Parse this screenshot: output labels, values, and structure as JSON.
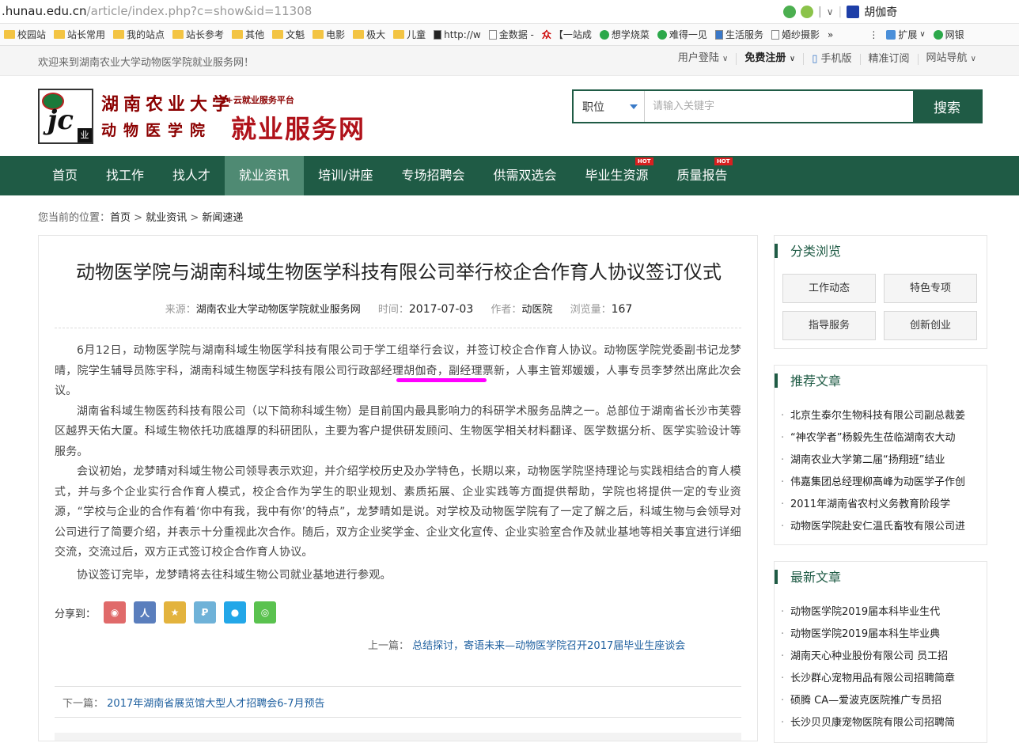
{
  "browser": {
    "url_domain": ".hunau.edu.cn",
    "url_path": "/article/index.php?c=show&id=11308",
    "user_name": "胡伽奇",
    "bookmarks": [
      "校园站",
      "站长常用",
      "我的站点",
      "站长参考",
      "其他",
      "文魁",
      "电影",
      "极大",
      "儿童",
      "http://w",
      "金数据 -",
      "【一站成",
      "想学烧菜",
      "难得一见",
      "生活服务",
      "婚纱摄影",
      "»",
      "⋮",
      "扩展",
      "网银"
    ]
  },
  "topbar": {
    "welcome": "欢迎来到湖南农业大学动物医学院就业服务网！",
    "links": [
      "用户登陆",
      "免费注册",
      "手机版",
      "精准订阅",
      "网站导航"
    ]
  },
  "logo": {
    "school": "湖南农业大学",
    "college": "动物医学院",
    "platform": "3+云就业服务平台",
    "site": "就业服务网",
    "badge_text": "jc",
    "badge_corner": "业"
  },
  "search": {
    "select_value": "职位",
    "placeholder": "请输入关键字",
    "button": "搜索"
  },
  "nav": {
    "items": [
      "首页",
      "找工作",
      "找人才",
      "就业资讯",
      "培训/讲座",
      "专场招聘会",
      "供需双选会",
      "毕业生资源",
      "质量报告"
    ],
    "active": "就业资讯",
    "hot_badge": "HOT"
  },
  "breadcrumb": {
    "prefix": "您当前的位置：",
    "items": [
      "首页",
      "就业资讯",
      "新闻速递"
    ],
    "sep": " > "
  },
  "article": {
    "title": "动物医学院与湖南科域生物医学科技有限公司举行校企合作育人协议签订仪式",
    "source_label": "来源：",
    "source": "湖南农业大学动物医学院就业服务网",
    "time_label": "时间：",
    "time": "2017-07-03",
    "author_label": "作者：",
    "author": "动医院",
    "views_label": "浏览量：",
    "views": "167",
    "paragraphs": [
      "6月12日，动物医学院与湖南科域生物医学科技有限公司于学工组举行会议，并签订校企合作育人协议。动物医学院党委副书记龙梦晴，院学生辅导员陈宇科，湖南科域生物医学科技有限公司行政部经理胡伽奇，副经理票新，人事主管郑媛媛，人事专员李梦然出席此次会议。",
      "湖南省科域生物医药科技有限公司（以下简称科域生物）是目前国内最具影响力的科研学术服务品牌之一。总部位于湖南省长沙市芙蓉区越界天佑大厦。科域生物依托功底雄厚的科研团队，主要为客户提供研发顾问、生物医学相关材料翻译、医学数据分析、医学实验设计等服务。",
      "会议初始，龙梦晴对科域生物公司领导表示欢迎，并介绍学校历史及办学特色，长期以来，动物医学院坚持理论与实践相结合的育人模式，并与多个企业实行合作育人模式，校企合作为学生的职业规划、素质拓展、企业实践等方面提供帮助，学院也将提供一定的专业资源，“学校与企业的合作有着‘你中有我，我中有你’的特点”，龙梦晴如是说。对学校及动物医学院有了一定了解之后，科域生物与会领导对公司进行了简要介绍，并表示十分重视此次合作。随后，双方企业奖学金、企业文化宣传、企业实验室合作及就业基地等相关事宜进行详细交流，交流过后，双方正式签订校企合作育人协议。",
      "协议签订完毕，龙梦晴将去往科域生物公司就业基地进行参观。"
    ],
    "share_label": "分享到：",
    "share_icons": [
      "weibo-icon",
      "renren-icon",
      "qzone-icon",
      "tencent-weibo-icon",
      "qq-icon",
      "wechat-icon"
    ],
    "share_colors": [
      "#e06a6a",
      "#5a7ebd",
      "#e3b33d",
      "#6fb2d8",
      "#23a7e8",
      "#5ac24f"
    ],
    "prev_label": "上一篇：",
    "prev_title": "总结探讨，寄语未来—动物医学院召开2017届毕业生座谈会",
    "next_label": "下一篇：",
    "next_title": "2017年湖南省展览馆大型人才招聘会6-7月预告"
  },
  "sidebar": {
    "category": {
      "title": "分类浏览",
      "buttons": [
        "工作动态",
        "特色专项",
        "指导服务",
        "创新创业"
      ]
    },
    "recommended": {
      "title": "推荐文章",
      "items": [
        "北京生泰尔生物科技有限公司副总裁姜",
        "“神农学者”杨毅先生莅临湖南农大动",
        "湖南农业大学第二届“扬翔班”结业",
        "伟嘉集团总经理柳高峰为动医学子作创",
        "2011年湖南省农村义务教育阶段学",
        "动物医学院赴安仁温氏畜牧有限公司进"
      ]
    },
    "latest": {
      "title": "最新文章",
      "items": [
        "动物医学院2019届本科毕业生代",
        "动物医学院2019届本科生毕业典",
        "湖南天心种业股份有限公司 员工招",
        "长沙群心宠物用品有限公司招聘简章",
        "硕腾 CA—爱波克医院推广专员招",
        "长沙贝贝康宠物医院有限公司招聘简"
      ]
    },
    "bullet": "·"
  },
  "colors": {
    "brand_green": "#1f5b45",
    "nav_active": "#4f8a73",
    "logo_red": "#b0121a",
    "link_blue": "#1c5e9e",
    "annotation_magenta": "#ff00ff"
  }
}
